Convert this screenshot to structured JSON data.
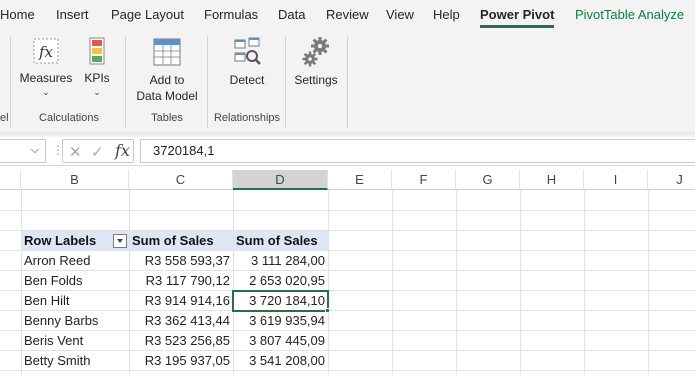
{
  "menu": {
    "tabs": [
      "Home",
      "Insert",
      "Page Layout",
      "Formulas",
      "Data",
      "Review",
      "View",
      "Help",
      "Power Pivot",
      "PivotTable Analyze"
    ],
    "active_tab": "Power Pivot"
  },
  "ribbon": {
    "left_fragment": "el",
    "measures_label": "Measures",
    "kpis_label": "KPIs",
    "add_to_label_1": "Add to",
    "add_to_label_2": "Data Model",
    "detect_label": "Detect",
    "settings_label": "Settings",
    "group_calculations": "Calculations",
    "group_tables": "Tables",
    "group_relationships": "Relationships"
  },
  "formula_bar": {
    "cancel_glyph": "✕",
    "enter_glyph": "✓",
    "fx_glyph": "fx",
    "value": "3720184,1"
  },
  "grid": {
    "columns": [
      "B",
      "C",
      "D",
      "E",
      "F",
      "G",
      "H",
      "I",
      "J"
    ],
    "selected_column": "D",
    "pivot_headers": [
      "Row Labels",
      "Sum of Sales",
      "Sum of Sales"
    ],
    "rows": [
      {
        "label": "Arron Reed",
        "c": "R3 558 593,37",
        "d": "3 111 284,00"
      },
      {
        "label": "Ben Folds",
        "c": "R3 117 790,12",
        "d": "2 653 020,95"
      },
      {
        "label": "Ben Hilt",
        "c": "R3 914 914,16",
        "d": "3 720 184,10"
      },
      {
        "label": "Benny Barbs",
        "c": "R3 362 413,44",
        "d": "3 619 935,94"
      },
      {
        "label": "Beris Vent",
        "c": "R3 523 256,85",
        "d": "3 807 445,09"
      },
      {
        "label": "Betty Smith",
        "c": "R3 195 937,05",
        "d": "3 541 208,00"
      }
    ]
  },
  "colors": {
    "accent_green": "#217346",
    "pivot_header_fill": "#dde6f5",
    "analyze_tab_text": "#0f7b3e"
  }
}
